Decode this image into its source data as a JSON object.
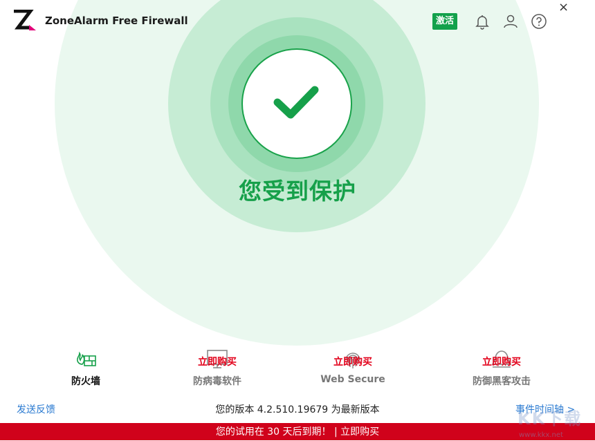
{
  "header": {
    "app_title": "ZoneAlarm Free Firewall",
    "activate_label": "激活",
    "close_label": "×"
  },
  "status": {
    "text": "您受到保护"
  },
  "features": [
    {
      "label": "防火墙",
      "buy_label": "",
      "state": "active"
    },
    {
      "label": "防病毒软件",
      "buy_label": "立即购买",
      "state": "inactive"
    },
    {
      "label": "Web Secure",
      "buy_label": "立即购买",
      "state": "inactive"
    },
    {
      "label": "防御黑客攻击",
      "buy_label": "立即购买",
      "state": "inactive"
    }
  ],
  "footer": {
    "feedback_label": "发送反馈",
    "version_text": "您的版本 4.2.510.19679 为最新版本",
    "timeline_label": "事件时间轴 >"
  },
  "banner": {
    "trial_text": "您的试用在 30 天后到期！",
    "separator": " | ",
    "buy_label": "立即购买"
  },
  "watermark": {
    "text": "KK下载",
    "url": "www.kkx.net"
  },
  "colors": {
    "accent_green": "#16a04a",
    "buy_red": "#e2001a",
    "banner_red": "#d0021b",
    "link_blue": "#2a7ad1"
  },
  "icons": {
    "logo": "zonealarm-logo-icon",
    "bell": "bell-icon",
    "user": "user-icon",
    "help": "help-icon",
    "check": "checkmark-icon",
    "firewall": "firewall-icon",
    "antivirus": "monitor-icon",
    "web": "fingerprint-icon",
    "hacker": "hacker-icon"
  }
}
